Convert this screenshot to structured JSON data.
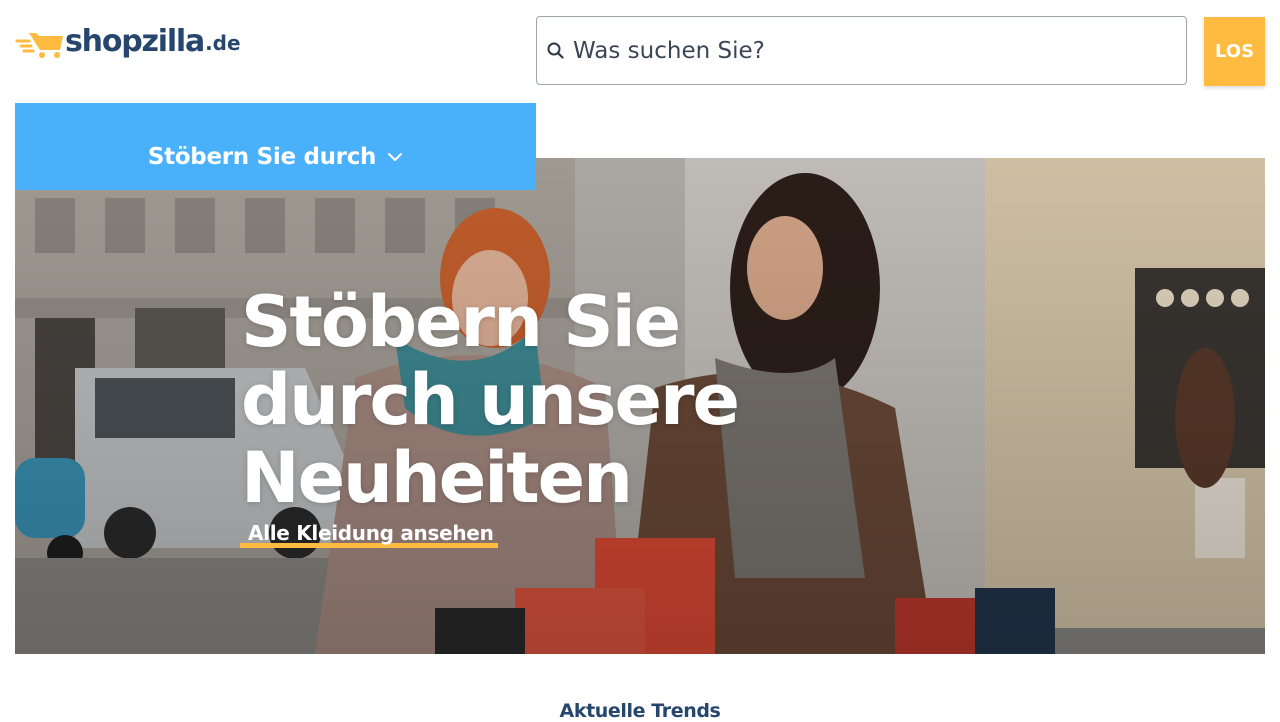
{
  "header": {
    "logo": {
      "name": "shopzilla",
      "tld": ".de",
      "icon": "shopping-cart-icon"
    },
    "search": {
      "placeholder": "Was suchen Sie?",
      "icon": "search-icon",
      "button_label": "LOS"
    }
  },
  "nav": {
    "browse_label": "Stöbern Sie durch",
    "icon": "chevron-down-icon"
  },
  "hero": {
    "title_lines": [
      "Stöbern Sie",
      "durch unsere",
      "Neuheiten"
    ],
    "cta_label": "Alle Kleidung ansehen"
  },
  "trends": {
    "heading": "Aktuelle Trends"
  },
  "colors": {
    "brand_navy": "#26466d",
    "brand_orange": "#ffbb3f",
    "browse_blue": "#49b1fc"
  }
}
